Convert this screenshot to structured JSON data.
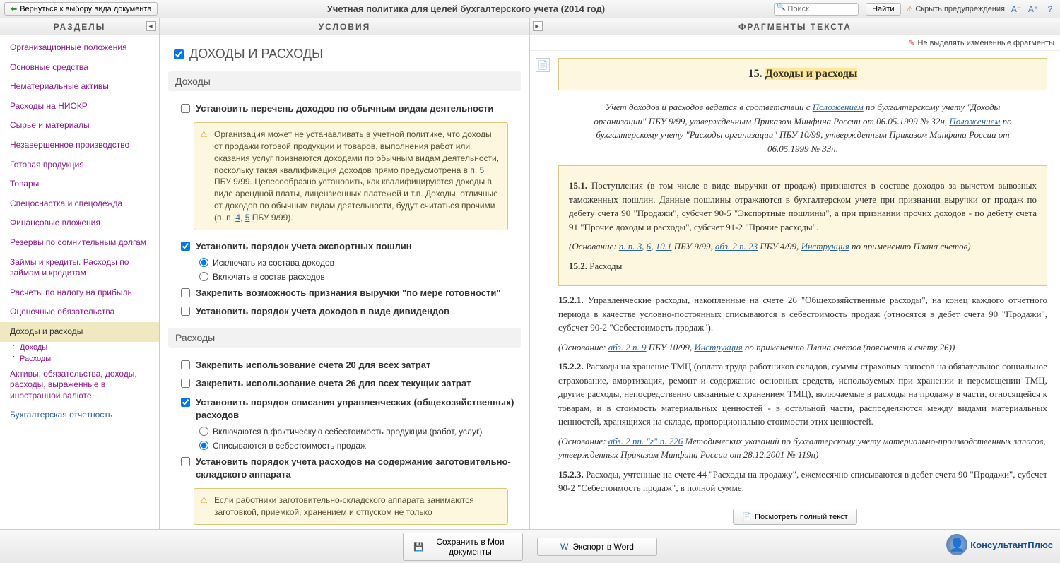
{
  "topbar": {
    "back": "Вернуться к выбору вида документа",
    "title": "Учетная политика для целей бухгалтерского учета (2014 год)",
    "search_placeholder": "Поиск",
    "find": "Найти",
    "hide_warnings": "Скрыть предупреждения"
  },
  "columns": {
    "left": "РАЗДЕЛЫ",
    "mid": "УСЛОВИЯ",
    "right": "ФРАГМЕНТЫ ТЕКСТА"
  },
  "sections": [
    "Организационные положения",
    "Основные средства",
    "Нематериальные активы",
    "Расходы на НИОКР",
    "Сырье и материалы",
    "Незавершенное производство",
    "Готовая продукция",
    "Товары",
    "Спецоснастка и спецодежда",
    "Финансовые вложения",
    "Резервы по сомнительным долгам",
    "Займы и кредиты. Расходы по займам и кредитам",
    "Расчеты по налогу на прибыль",
    "Оценочные обязательства"
  ],
  "active_section": "Доходы и расходы",
  "sub_sections": [
    "Доходы",
    "Расходы"
  ],
  "after_sections": [
    "Активы, обязательства, доходы, расходы, выраженные в иностранной валюте"
  ],
  "blue_section": "Бухгалтерская отчетность",
  "conditions": {
    "title": "ДОХОДЫ И РАСХОДЫ",
    "group1": "Доходы",
    "c1": "Установить перечень доходов по обычным видам деятельности",
    "note1_a": "Организация может не устанавливать в учетной политике, что доходы от продажи готовой продукции и товаров, выполнения работ или оказания услуг признаются доходами по обычным видам деятельности, поскольку такая квалификация доходов прямо предусмотрена в ",
    "note1_link": "п. 5",
    "note1_b": " ПБУ 9/99. Целесообразно установить, как квалифицируются доходы в виде арендной платы, лицензионных платежей и т.п. Доходы, отличные от доходов по обычным видам деятельности, будут считаться прочими (п. п. ",
    "note1_l4": "4",
    "note1_l5": "5",
    "note1_c": " ПБУ 9/99).",
    "c2": "Установить порядок учета экспортных пошлин",
    "r2a": "Исключать из состава доходов",
    "r2b": "Включать в состав расходов",
    "c3": "Закрепить возможность признания выручки \"по мере готовности\"",
    "c4": "Установить порядок учета доходов в виде дивидендов",
    "group2": "Расходы",
    "c5": "Закрепить использование счета 20 для всех затрат",
    "c6": "Закрепить использование счета 26 для всех текущих затрат",
    "c7": "Установить порядок списания управленческих (общехозяйственных) расходов",
    "r7a": "Включаются в фактическую себестоимость продукции (работ, услуг)",
    "r7b": "Списываются в себестоимость продаж",
    "c8": "Установить порядок учета расходов на содержание заготовительно-складского аппарата",
    "note8": "Если работники заготовительно-складского аппарата занимаются заготовкой, приемкой, хранением и отпуском не только"
  },
  "fragments": {
    "no_highlight": "Не выделять измененные фрагменты",
    "title_num": "15. ",
    "title_text": "Доходы и расходы",
    "intro_a": "Учет доходов и расходов ведется в соответствии с ",
    "intro_l1": "Положением",
    "intro_b": " по бухгалтерскому учету \"Доходы организации\" ПБУ 9/99, утвержденным Приказом Минфина России от 06.05.1999 № 32н, ",
    "intro_l2": "Положением",
    "intro_c": " по бухгалтерскому учету \"Расходы организации\" ПБУ 10/99, утвержденным Приказом Минфина России от 06.05.1999 № 33н.",
    "p151": "15.1.",
    "p151_text": " Поступления (в том числе в виде выручки от продаж) признаются в составе доходов за вычетом вывозных таможенных пошлин. Данные пошлины отражаются в бухгалтерском учете при признании выручки от продаж по дебету счета 90 \"Продажи\", субсчет 90-5 \"Экспортные пошлины\", а при признании прочих доходов - по дебету счета 91 \"Прочие доходы и расходы\", субсчет 91-2 \"Прочие расходы\".",
    "cite1_a": "(Основание: ",
    "cite1_l1": "п. п. 3",
    "cite1_l2": "6",
    "cite1_l3": "10.1",
    "cite1_m1": " ПБУ 9/99, ",
    "cite1_l4": "абз. 2 п. 23",
    "cite1_m2": " ПБУ 4/99, ",
    "cite1_l5": "Инструкция",
    "cite1_b": " по применению Плана счетов)",
    "p152": "15.2.",
    "p152_text": " Расходы",
    "p1521": "15.2.1.",
    "p1521_text": " Управленческие расходы, накопленные на счете 26 \"Общехозяйственные расходы\", на конец каждого отчетного периода в качестве условно-постоянных списываются в себестоимость продаж (относятся в дебет счета 90 \"Продажи\", субсчет 90-2 \"Себестоимость продаж\").",
    "cite2_a": "(Основание: ",
    "cite2_l1": "абз. 2 п. 9",
    "cite2_m": " ПБУ 10/99, ",
    "cite2_l2": "Инструкция",
    "cite2_b": " по применению Плана счетов (пояснения к счету 26))",
    "p1522": "15.2.2.",
    "p1522_text": " Расходы на хранение ТМЦ (оплата труда работников складов, суммы страховых взносов на обязательное социальное страхование, амортизация, ремонт и содержание основных средств, используемых при хранении и перемещении ТМЦ, другие расходы, непосредственно связанные с хранением ТМЦ), включаемые в расходы на продажу в части, относящейся к товарам, и в стоимость материальных ценностей - в остальной части, распределяются между видами материальных ценностей, хранящихся на складе, пропорционально стоимости этих ценностей.",
    "cite3_a": "(Основание: ",
    "cite3_l1": "абз. 2 пп. \"г\" п. 226",
    "cite3_b": " Методических указаний по бухгалтерскому учету материально-производственных запасов, утвержденных Приказом Минфина России от 28.12.2001 № 119н)",
    "p1523": "15.2.3.",
    "p1523_text": " Расходы, учтенные на счете 44 \"Расходы на продажу\", ежемесячно списываются в дебет счета 90 \"Продажи\", субсчет 90-2 \"Себестоимость продаж\", в полной сумме.",
    "full_text_btn": "Посмотреть полный текст"
  },
  "footer": {
    "save": "Сохранить в Мои документы",
    "export": "Экспорт в Word",
    "logo": "КонсультантПлюс"
  }
}
